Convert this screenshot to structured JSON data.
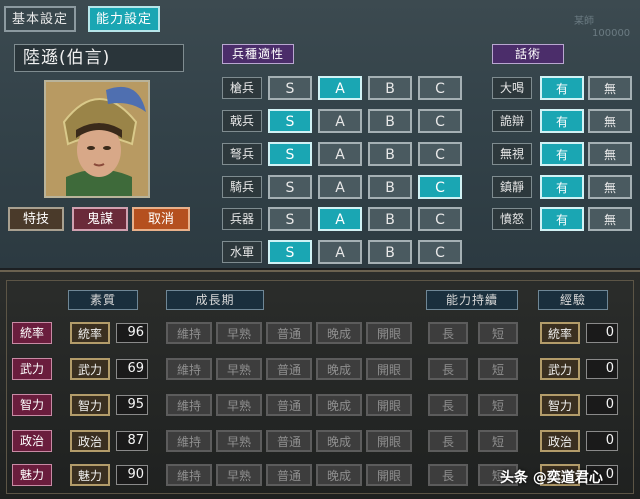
{
  "tabs": [
    "基本設定",
    "能力設定"
  ],
  "faint_text": [
    "某師",
    "100000"
  ],
  "character": {
    "name": "陸遜(伯言)"
  },
  "commands": [
    "特技",
    "鬼謀",
    "取消"
  ],
  "colors": {
    "accent": "#1aa6b3",
    "header_purple": "#4b2d6a",
    "stat_label": "#6a1d3d"
  },
  "aptitude": {
    "title": "兵種適性",
    "grades": [
      "S",
      "A",
      "B",
      "C"
    ],
    "rows": [
      {
        "label": "槍兵",
        "selected": "A"
      },
      {
        "label": "戟兵",
        "selected": "S"
      },
      {
        "label": "弩兵",
        "selected": "S"
      },
      {
        "label": "騎兵",
        "selected": "C"
      },
      {
        "label": "兵器",
        "selected": "A"
      },
      {
        "label": "水軍",
        "selected": "S"
      }
    ]
  },
  "debate": {
    "title": "話術",
    "options": [
      "有",
      "無"
    ],
    "rows": [
      {
        "label": "大喝",
        "selected": "有"
      },
      {
        "label": "詭辯",
        "selected": "有"
      },
      {
        "label": "無視",
        "selected": "有"
      },
      {
        "label": "鎮靜",
        "selected": "有"
      },
      {
        "label": "憤怒",
        "selected": "有"
      }
    ]
  },
  "ability": {
    "headers": {
      "quality": "素質",
      "growth": "成長期",
      "duration": "能力持續",
      "exp": "經驗"
    },
    "growth_options": [
      "維持",
      "早熟",
      "普通",
      "晚成",
      "開眼"
    ],
    "duration_options": [
      "長",
      "短"
    ],
    "stats": [
      {
        "label": "統率",
        "value": "96",
        "exp": "0"
      },
      {
        "label": "武力",
        "value": "69",
        "exp": "0"
      },
      {
        "label": "智力",
        "value": "95",
        "exp": "0"
      },
      {
        "label": "政治",
        "value": "87",
        "exp": "0"
      },
      {
        "label": "魅力",
        "value": "90",
        "exp": "0"
      }
    ]
  },
  "watermark": "头条 @奕道君心"
}
